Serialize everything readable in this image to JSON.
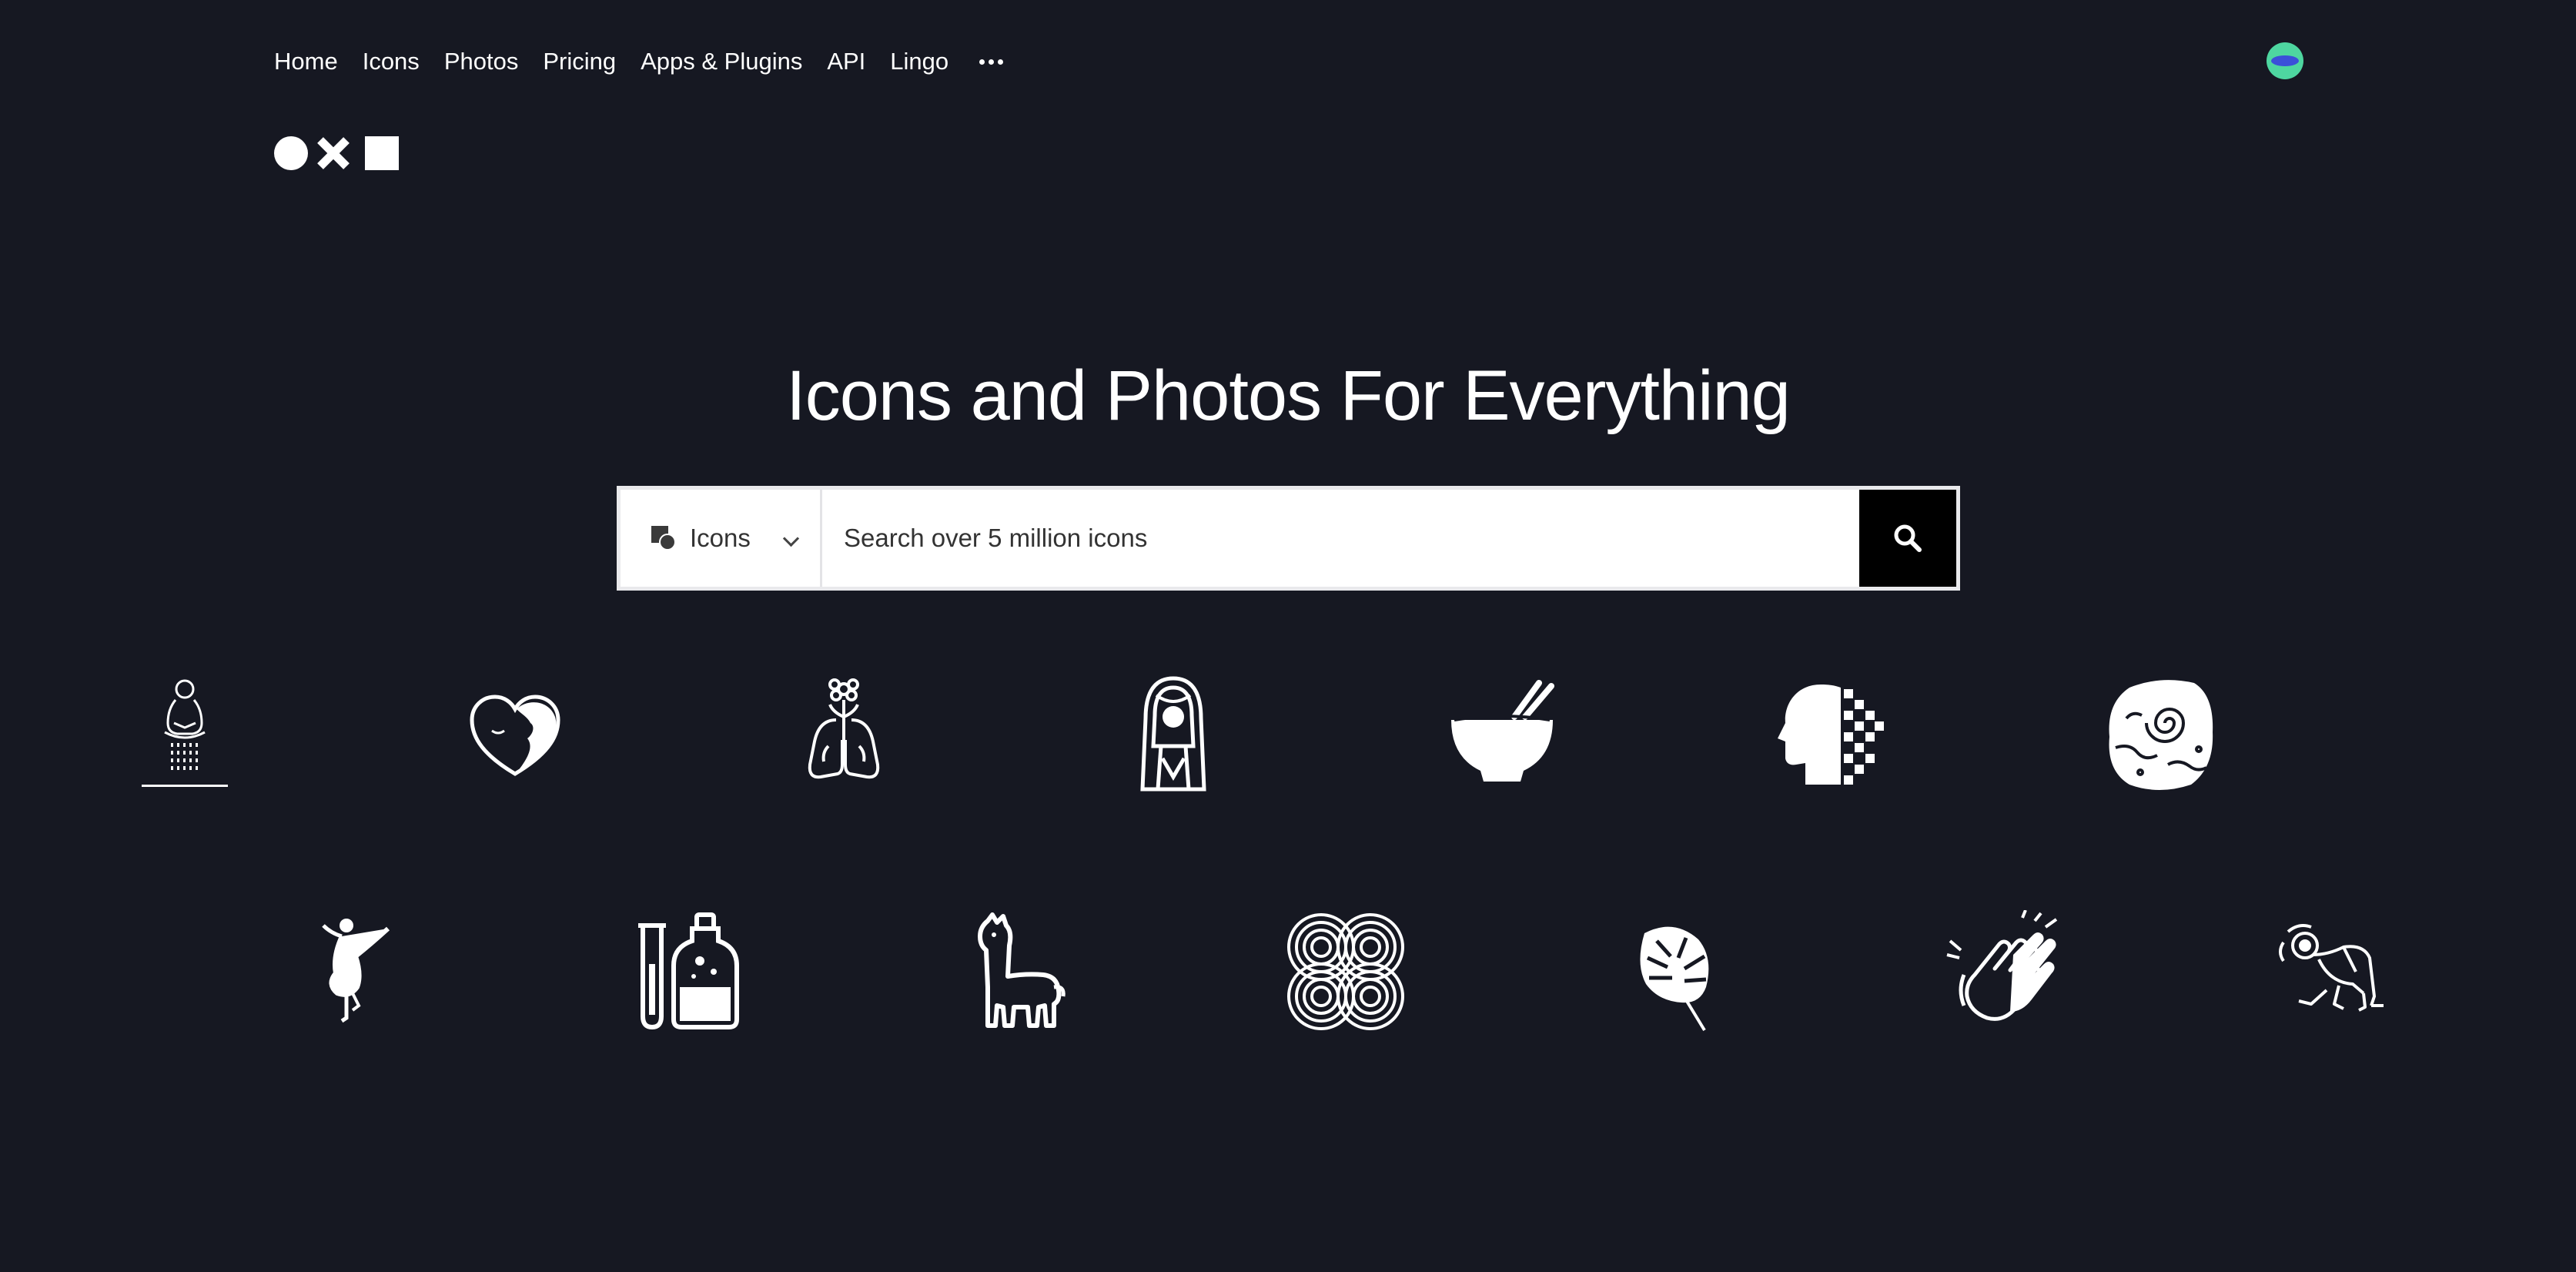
{
  "nav": {
    "items": [
      "Home",
      "Icons",
      "Photos",
      "Pricing",
      "Apps & Plugins",
      "API",
      "Lingo"
    ],
    "more_icon": "ellipsis-icon"
  },
  "avatar": {
    "icon": "user-avatar"
  },
  "logo": {
    "icon": "noun-project-logo"
  },
  "hero": {
    "title": "Icons and Photos For Everything"
  },
  "search": {
    "type_label": "Icons",
    "type_icon": "icons-type-icon",
    "placeholder": "Search over 5 million icons",
    "button_icon": "search-icon"
  },
  "icons_row1": [
    "meditation-statue-icon",
    "heart-face-icon",
    "flower-lungs-icon",
    "virgin-mary-icon",
    "noodle-bowl-icon",
    "pixel-head-icon",
    "fossil-rock-icon"
  ],
  "icons_row2": [
    "dancer-icon",
    "test-tube-bottle-icon",
    "llama-icon",
    "concentric-circles-icon",
    "monstera-leaf-icon",
    "clapping-hands-icon",
    "breakdancer-icon"
  ],
  "colors": {
    "background": "#161822",
    "text": "#ffffff",
    "search_button": "#000000",
    "avatar": "#4ed6a0"
  }
}
